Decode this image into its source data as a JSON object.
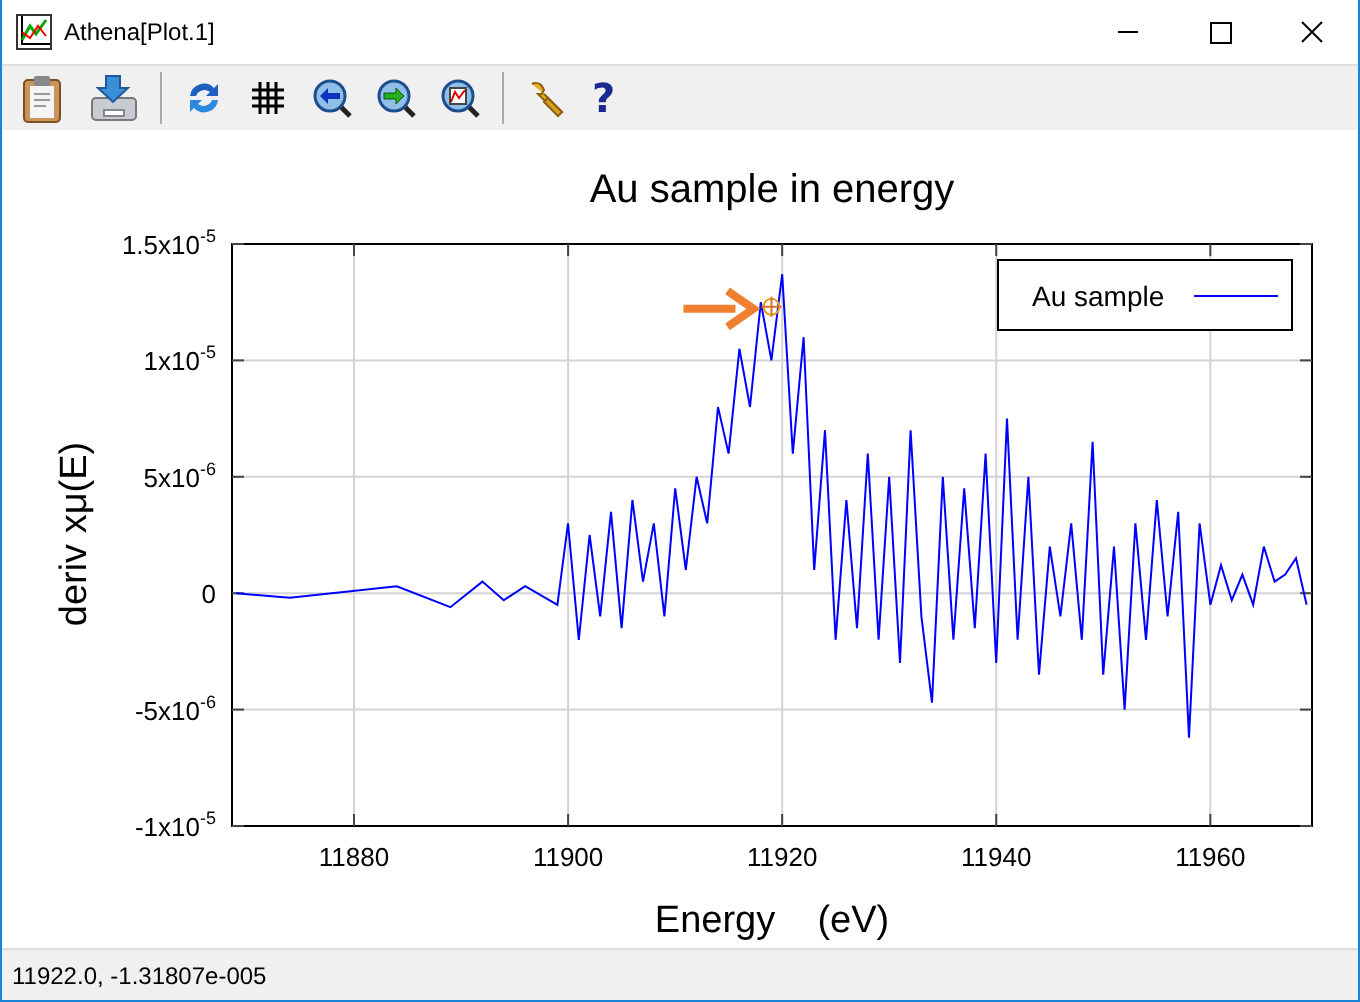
{
  "window": {
    "title": "Athena[Plot.1]"
  },
  "toolbar": [
    {
      "kind": "clipboard"
    },
    {
      "kind": "save"
    },
    {
      "kind": "separator"
    },
    {
      "kind": "refresh"
    },
    {
      "kind": "grid"
    },
    {
      "kind": "zoom-back"
    },
    {
      "kind": "zoom-forward"
    },
    {
      "kind": "zoom-reset"
    },
    {
      "kind": "separator"
    },
    {
      "kind": "settings"
    },
    {
      "kind": "help",
      "label": "?"
    }
  ],
  "plot": {
    "chart_data": {
      "type": "line",
      "title": "Au sample in energy",
      "xlabel": "Energy    (eV)",
      "ylabel": "deriv xμ(E)",
      "xlim": [
        11868.6,
        11969.5
      ],
      "ylim": [
        -1e-05,
        1.5e-05
      ],
      "xticks": [
        11880,
        11900,
        11920,
        11940,
        11960
      ],
      "yticks": [
        {
          "value": 1.5e-05,
          "label": "1.5x10$^{-5}$"
        },
        {
          "value": 1e-05,
          "label": "1x10$^{-5}$"
        },
        {
          "value": 5e-06,
          "label": "5x10$^{-6}$"
        },
        {
          "value": 0,
          "label": "0"
        },
        {
          "value": -5e-06,
          "label": "-5x10$^{-6}$"
        },
        {
          "value": -1e-05,
          "label": "-1x10$^{-5}$"
        }
      ],
      "x": [
        11869,
        11874,
        11884,
        11889,
        11892,
        11894,
        11896,
        11899,
        11900,
        11901,
        11902,
        11903,
        11904,
        11905,
        11906,
        11907,
        11908,
        11909,
        11910,
        11911,
        11912,
        11913,
        11914,
        11915,
        11916,
        11917,
        11918,
        11919,
        11920,
        11921,
        11922,
        11923,
        11924,
        11925,
        11926,
        11927,
        11928,
        11929,
        11930,
        11931,
        11932,
        11933,
        11934,
        11935,
        11936,
        11937,
        11938,
        11939,
        11940,
        11941,
        11942,
        11943,
        11944,
        11945,
        11946,
        11947,
        11948,
        11949,
        11950,
        11951,
        11952,
        11953,
        11954,
        11955,
        11956,
        11957,
        11958,
        11959,
        11960,
        11961,
        11962,
        11963,
        11964,
        11965,
        11966,
        11967,
        11968,
        11969
      ],
      "series": [
        {
          "name": "Au sample",
          "color": "#0000ff",
          "values": [
            0,
            -2e-07,
            3e-07,
            -6e-07,
            5e-07,
            -3e-07,
            3e-07,
            -5e-07,
            3e-06,
            -2e-06,
            2.5e-06,
            -1e-06,
            3.5e-06,
            -1.5e-06,
            4e-06,
            5e-07,
            3e-06,
            -1e-06,
            4.5e-06,
            1e-06,
            5e-06,
            3e-06,
            8e-06,
            6e-06,
            1.05e-05,
            8e-06,
            1.25e-05,
            1e-05,
            1.37e-05,
            6e-06,
            1.1e-05,
            1e-06,
            7e-06,
            -2e-06,
            4e-06,
            -1.5e-06,
            6e-06,
            -2e-06,
            5e-06,
            -3e-06,
            7e-06,
            -1e-06,
            -4.7e-06,
            5e-06,
            -2e-06,
            4.5e-06,
            -1.5e-06,
            6e-06,
            -3e-06,
            7.5e-06,
            -2e-06,
            5e-06,
            -3.5e-06,
            2e-06,
            -1e-06,
            3e-06,
            -2e-06,
            6.5e-06,
            -3.5e-06,
            2e-06,
            -5e-06,
            3e-06,
            -2e-06,
            4e-06,
            -1e-06,
            3.5e-06,
            -6.2e-06,
            3e-06,
            -5e-07,
            1.2e-06,
            -3e-07,
            8e-07,
            -5e-07,
            2e-06,
            5e-07,
            8e-07,
            1.5e-06,
            -5e-07
          ]
        }
      ],
      "grid": true
    },
    "pointer": true
  },
  "status_bar": {
    "text": "11922.0, -1.31807e-005"
  }
}
